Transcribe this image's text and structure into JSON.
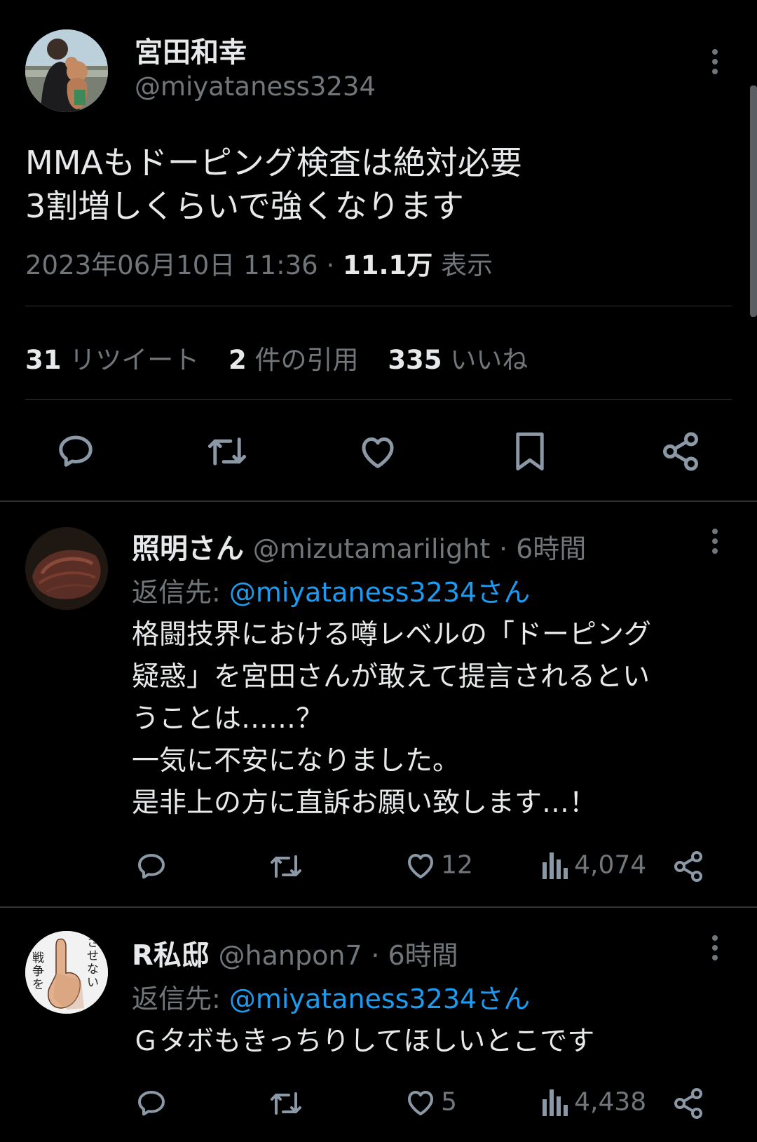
{
  "main_tweet": {
    "display_name": "宮田和幸",
    "handle": "@miyataness3234",
    "text_line1": "MMAもドーピング検査は絶対必要",
    "text_line2": "3割増しくらいで強くなります",
    "date": "2023年06月10日 11:36",
    "dot": "·",
    "views_count": "11.1万",
    "views_label": "表示",
    "stats": {
      "retweets_count": "31",
      "retweets_label": "リツイート",
      "quotes_count": "2",
      "quotes_label": "件の引用",
      "likes_count": "335",
      "likes_label": "いいね"
    },
    "actions": [
      "reply-icon",
      "retweet-icon",
      "like-icon",
      "bookmark-icon",
      "share-icon"
    ]
  },
  "replies": [
    {
      "display_name": "照明さん",
      "handle": "@mizutamarilight",
      "time": "· 6時間",
      "reply_to_label": "返信先:",
      "reply_to_handle": "@miyataness3234さん",
      "lines": [
        "格闘技界における噂レベルの「ドーピング",
        "疑惑」を宮田さんが敢えて提言されるとい",
        "うことは……？",
        "一気に不安になりました。",
        "是非上の方に直訴お願い致します…！"
      ],
      "likes": "12",
      "views": "4,074"
    },
    {
      "display_name": "R私邸",
      "handle": "@hanpon7",
      "time": "· 6時間",
      "reply_to_label": "返信先:",
      "reply_to_handle": "@miyataness3234さん",
      "lines": [
        "Ｇタボもきっちりしてほしいとこです"
      ],
      "likes": "5",
      "views": "4,438",
      "avatar_text": [
        "させない",
        "戦争を"
      ]
    }
  ],
  "colors": {
    "background": "#000000",
    "text": "#e7e9ea",
    "muted": "#71767b",
    "link": "#1d9bf0",
    "divider": "#2f3336"
  }
}
